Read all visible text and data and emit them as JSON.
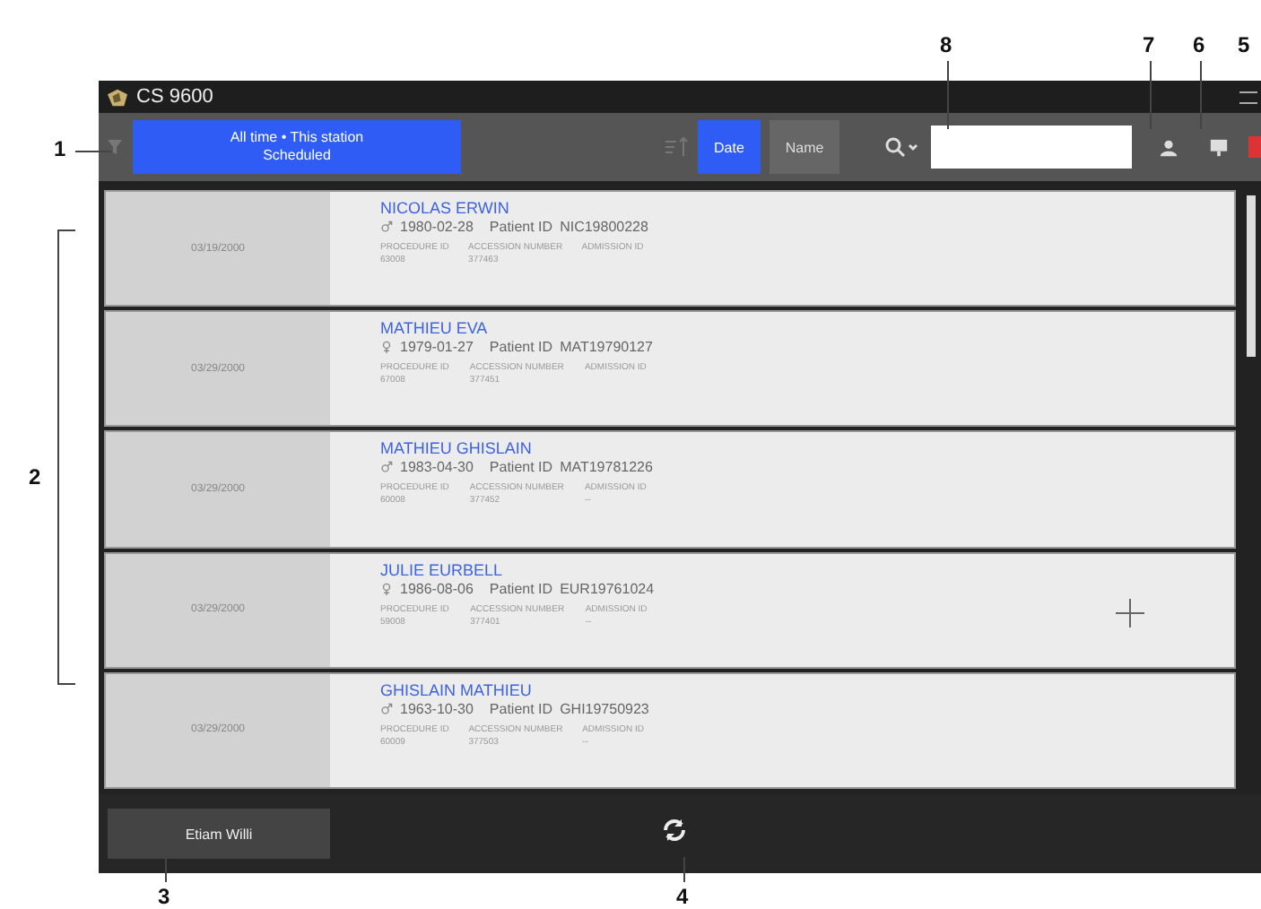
{
  "window": {
    "title": "CS 9600"
  },
  "toolbar": {
    "filter_label": "All time • This station",
    "filter_sublabel": "Scheduled",
    "sort_options": [
      {
        "label": "Date",
        "selected": true
      },
      {
        "label": "Name",
        "selected": false
      }
    ]
  },
  "patients": [
    {
      "date": "03/19/2000",
      "name": "NICOLAS ERWIN",
      "kind": "male",
      "birth_date": "1980-02-28",
      "patient_id_label": "Patient ID",
      "patient_id": "NIC19800228",
      "procedure_label": "PROCEDURE ID",
      "procedure_id": "63008",
      "accession_label": "ACCESSION NUMBER",
      "accession": "377463",
      "admission_label": "ADMISSION ID"
    },
    {
      "date": "03/29/2000",
      "name": "MATHIEU EVA",
      "kind": "female",
      "birth_date": "1979-01-27",
      "patient_id_label": "Patient ID",
      "patient_id": "MAT19790127",
      "procedure_label": "PROCEDURE ID",
      "procedure_id": "67008",
      "accession_label": "ACCESSION NUMBER",
      "accession": "377451",
      "admission_label": "ADMISSION ID"
    },
    {
      "date": "03/29/2000",
      "name": "MATHIEU GHISLAIN",
      "kind": "male",
      "birth_date": "1983-04-30",
      "patient_id_label": "Patient ID",
      "patient_id": "MAT19781226",
      "procedure_label": "PROCEDURE ID",
      "procedure_id": "60008",
      "accession_label": "ACCESSION NUMBER",
      "accession": "377452",
      "admission_label": "ADMISSION ID",
      "admission": "--"
    },
    {
      "date": "03/29/2000",
      "name": "JULIE EURBELL",
      "kind": "female",
      "birth_date": "1986-08-06",
      "patient_id_label": "Patient ID",
      "patient_id": "EUR19761024",
      "procedure_label": "PROCEDURE ID",
      "procedure_id": "59008",
      "accession_label": "ACCESSION NUMBER",
      "accession": "377401",
      "admission_label": "ADMISSION ID",
      "admission": "--"
    },
    {
      "date": "03/29/2000",
      "name": "GHISLAIN MATHIEU",
      "kind": "male",
      "birth_date": "1963-10-30",
      "patient_id_label": "Patient ID",
      "patient_id": "GHI19750923",
      "procedure_label": "PROCEDURE ID",
      "procedure_id": "60009",
      "accession_label": "ACCESSION NUMBER",
      "accession": "377503",
      "admission_label": "ADMISSION ID",
      "admission": "--"
    }
  ],
  "footer": {
    "user": "Etiam Willi"
  },
  "callouts": [
    "8",
    "7",
    "6",
    "5",
    "1",
    "2",
    "3",
    "4"
  ]
}
